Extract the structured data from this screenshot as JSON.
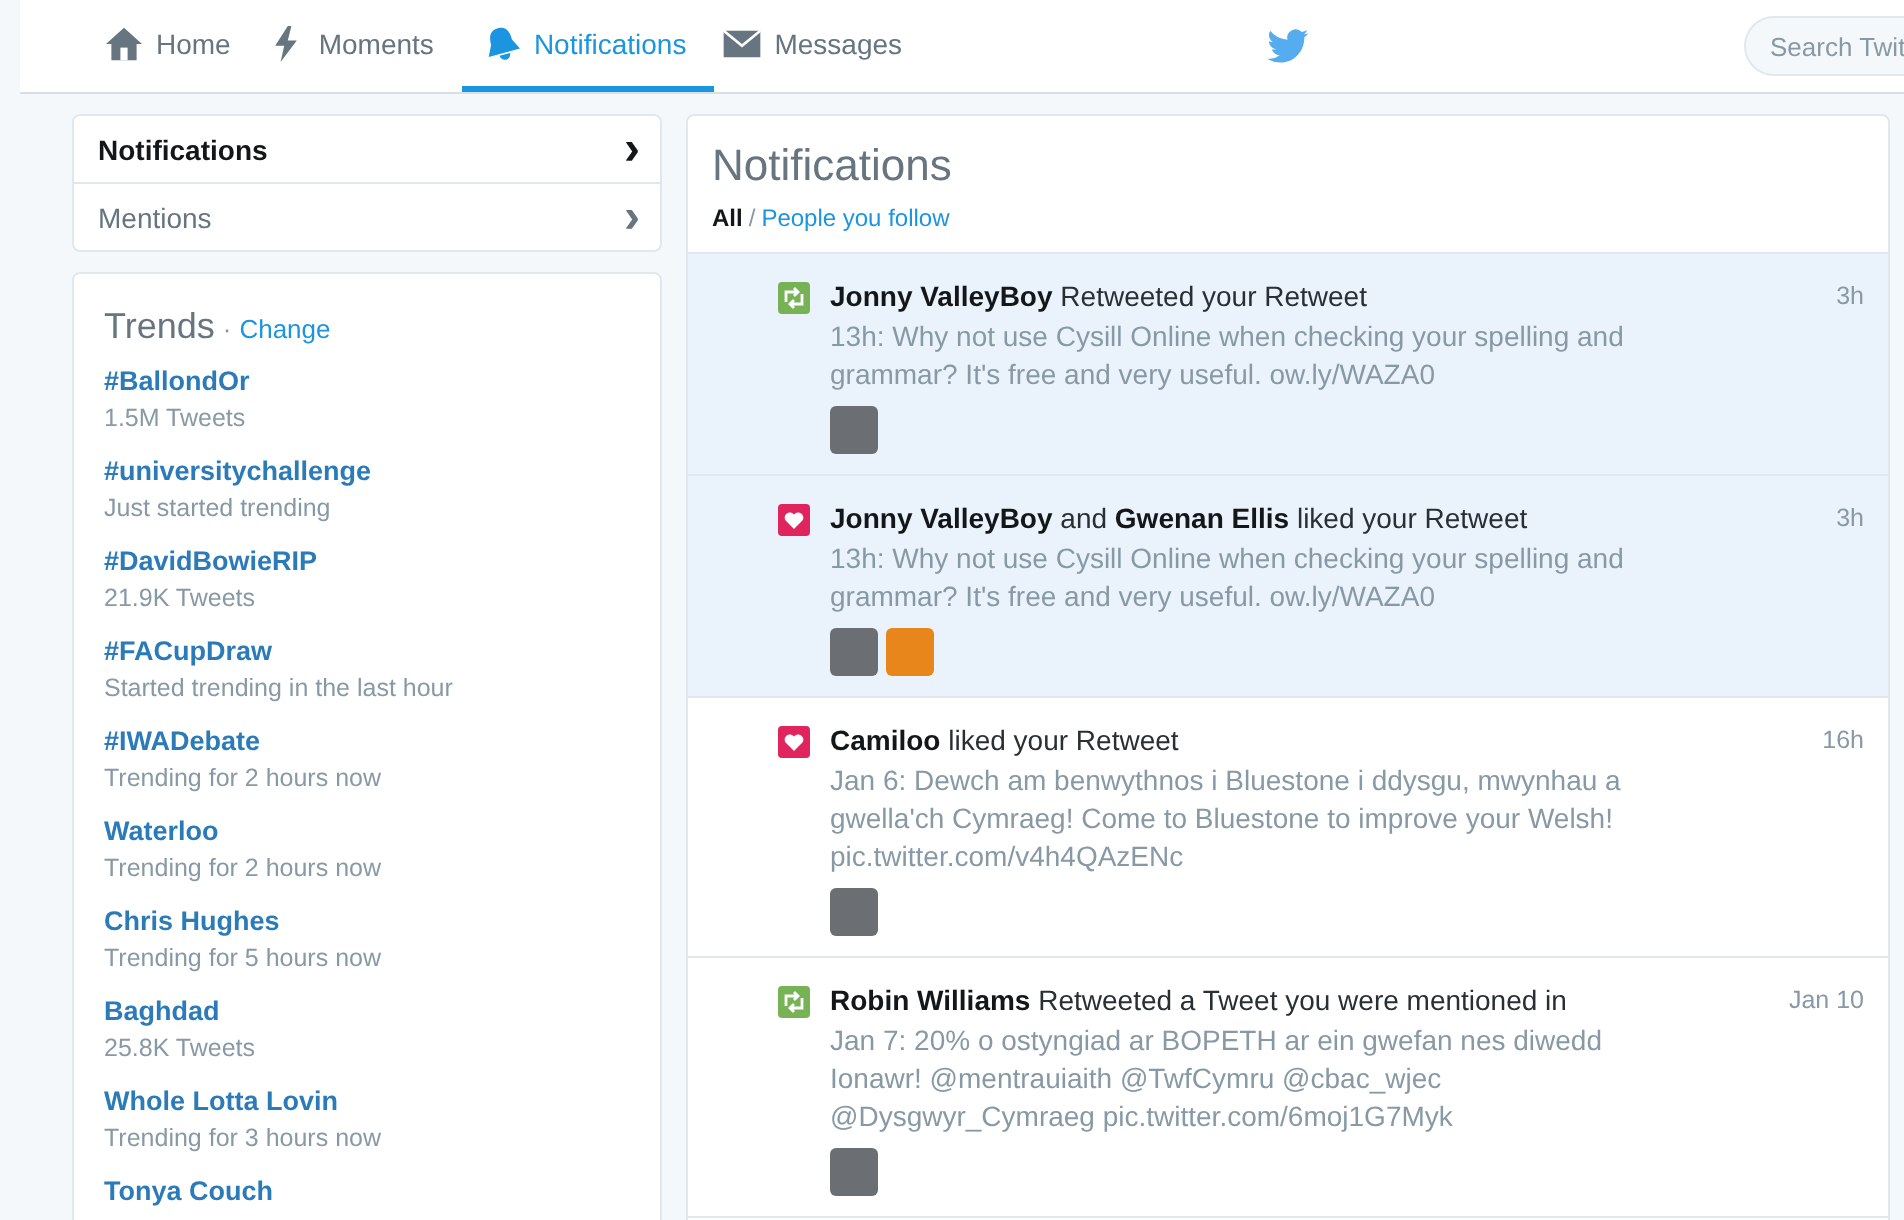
{
  "nav": {
    "tabs": [
      {
        "label": "Home",
        "selected": false
      },
      {
        "label": "Moments",
        "selected": false
      },
      {
        "label": "Notifications",
        "selected": true
      },
      {
        "label": "Messages",
        "selected": false
      }
    ],
    "search": {
      "placeholder": "Search Twit"
    }
  },
  "sidebar": {
    "items": [
      {
        "label": "Notifications",
        "selected": true,
        "chevron": "›"
      },
      {
        "label": "Mentions",
        "selected": false,
        "chevron": "›"
      }
    ]
  },
  "trends": {
    "title": "Trends",
    "separator": "·",
    "change": "Change",
    "items": [
      {
        "name": "#BallondOr",
        "detail": "1.5M Tweets"
      },
      {
        "name": "#universitychallenge",
        "detail": "Just started trending"
      },
      {
        "name": "#DavidBowieRIP",
        "detail": "21.9K Tweets"
      },
      {
        "name": "#FACupDraw",
        "detail": "Started trending in the last hour"
      },
      {
        "name": "#IWADebate",
        "detail": "Trending for 2 hours now"
      },
      {
        "name": "Waterloo",
        "detail": "Trending for 2 hours now"
      },
      {
        "name": "Chris Hughes",
        "detail": "Trending for 5 hours now"
      },
      {
        "name": "Baghdad",
        "detail": "25.8K Tweets"
      },
      {
        "name": "Whole Lotta Lovin",
        "detail": "Trending for 3 hours now"
      },
      {
        "name": "Tonya Couch"
      }
    ]
  },
  "main": {
    "title": "Notifications",
    "filter_separator": "/",
    "filters": [
      {
        "label": "All",
        "selected": true
      },
      {
        "label": "People you follow",
        "selected": false
      }
    ],
    "notifications": [
      {
        "kind": "retweet",
        "unread": true,
        "headline": "**Jonny ValleyBoy** Retweeted your Retweet",
        "time": "3h",
        "text": "13h: Why not use Cysill Online when checking your spelling and grammar? It's free and very useful. ow.ly/WAZA0",
        "avatars": [
          {
            "kind": "photo"
          }
        ]
      },
      {
        "kind": "like",
        "unread": true,
        "headline": "**Jonny ValleyBoy** and **Gwenan Ellis** liked your Retweet",
        "time": "3h",
        "text": "13h: Why not use Cysill Online when checking your spelling and grammar? It's free and very useful. ow.ly/WAZA0",
        "avatars": [
          {
            "kind": "photo"
          },
          {
            "kind": "photo"
          }
        ]
      },
      {
        "kind": "like",
        "unread": false,
        "headline": "**Camiloo** liked your Retweet",
        "time": "16h",
        "text": "Jan 6: Dewch am benwythnos i Bluestone i ddysgu, mwynhau a gwella'ch Cymraeg! Come to Bluestone to improve your Welsh! pic.twitter.com/v4h4QAzENc",
        "avatars": [
          {
            "kind": "photo"
          }
        ]
      },
      {
        "kind": "retweet",
        "unread": false,
        "headline": "**Robin Williams** Retweeted a Tweet you were mentioned in",
        "time": "Jan 10",
        "text": "Jan 7: 20% o ostyngiad ar BOPETH ar ein gwefan nes diwedd Ionawr! @mentrauiaith @TwfCymru  @cbac_wjec @Dysgwyr_Cymraeg pic.twitter.com/6moj1G7Myk",
        "avatars": [
          {
            "kind": "photo"
          }
        ]
      }
    ]
  }
}
